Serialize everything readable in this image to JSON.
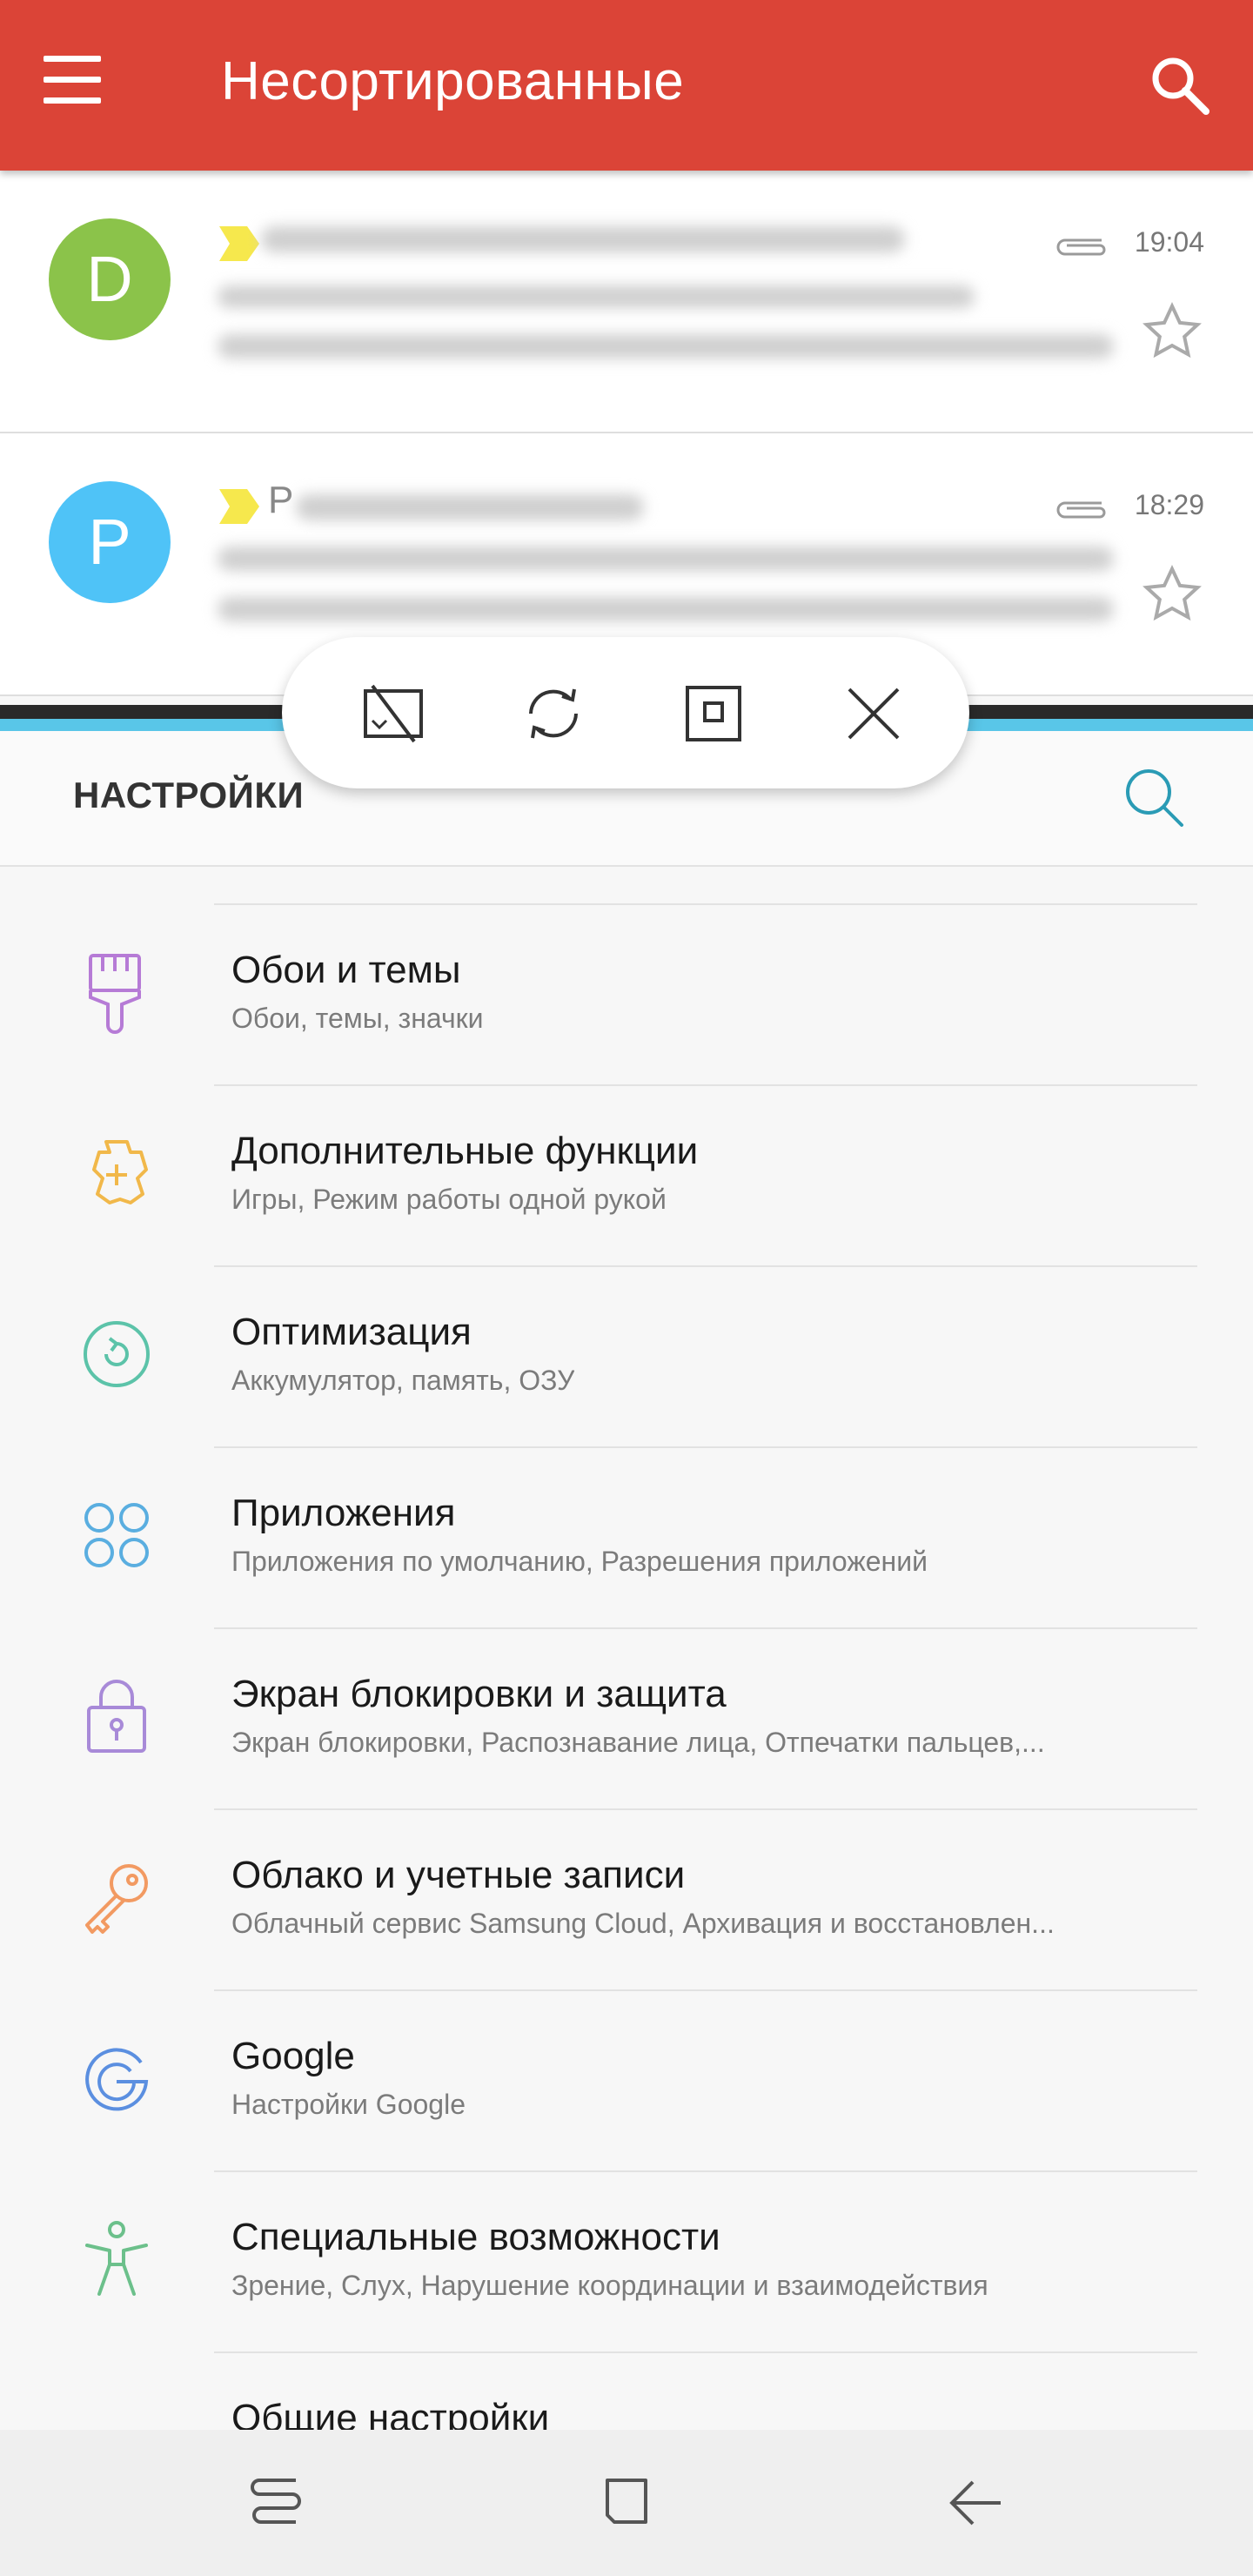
{
  "mail_app": {
    "title": "Несортированные",
    "messages": [
      {
        "avatar_letter": "D",
        "avatar_color": "#8bc34a",
        "time": "19:04",
        "sender_visible": ""
      },
      {
        "avatar_letter": "P",
        "avatar_color": "#4fc3f7",
        "time": "18:29",
        "sender_visible": "Р"
      }
    ]
  },
  "split_toolbar": {
    "buttons": [
      "swap-windows-icon",
      "rotate-icon",
      "maximize-icon",
      "close-icon"
    ]
  },
  "settings": {
    "title": "НАСТРОЙКИ",
    "items": [
      {
        "title": "Обои и темы",
        "subtitle": "Обои, темы, значки",
        "icon": "paintbrush-icon",
        "color": "#b67bd6"
      },
      {
        "title": "Дополнительные функции",
        "subtitle": "Игры, Режим работы одной рукой",
        "icon": "puzzle-gear-icon",
        "color": "#f1b84a"
      },
      {
        "title": "Оптимизация",
        "subtitle": "Аккумулятор, память, ОЗУ",
        "icon": "optimization-icon",
        "color": "#5cc3a9"
      },
      {
        "title": "Приложения",
        "subtitle": "Приложения по умолчанию, Разрешения приложений",
        "icon": "apps-grid-icon",
        "color": "#5aaee0"
      },
      {
        "title": "Экран блокировки и защита",
        "subtitle": "Экран блокировки, Распознавание лица, Отпечатки пальцев,...",
        "icon": "lock-icon",
        "color": "#a88ad8"
      },
      {
        "title": "Облако и учетные записи",
        "subtitle": "Облачный сервис Samsung Cloud, Архивация и восстановлен...",
        "icon": "key-icon",
        "color": "#f29a62"
      },
      {
        "title": "Google",
        "subtitle": "Настройки Google",
        "icon": "google-g-icon",
        "color": "#5b8fe0"
      },
      {
        "title": "Специальные возможности",
        "subtitle": "Зрение, Слух, Нарушение координации и взаимодействия",
        "icon": "accessibility-icon",
        "color": "#6cc08b"
      },
      {
        "title": "Общие настройки",
        "subtitle": "",
        "icon": "sliders-icon",
        "color": "#8a8a8a"
      }
    ]
  },
  "navbar": {
    "buttons": [
      "recents-icon",
      "home-icon",
      "back-icon"
    ]
  }
}
